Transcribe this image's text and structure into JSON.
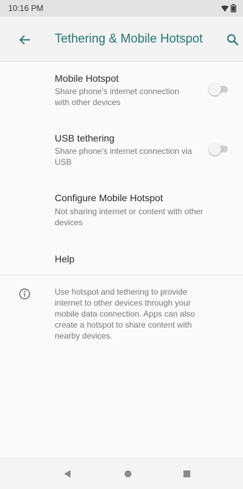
{
  "status_bar": {
    "time": "10:16 PM"
  },
  "app_bar": {
    "title": "Tethering & Mobile Hotspot"
  },
  "preferences": [
    {
      "title": "Mobile Hotspot",
      "summary": "Share phone's internet connection with other devices",
      "toggle_on": false
    },
    {
      "title": "USB tethering",
      "summary": "Share phone's internet connection via USB",
      "toggle_on": false
    },
    {
      "title": "Configure Mobile Hotspot",
      "summary": "Not sharing internet or content with other devices"
    },
    {
      "title": "Help"
    }
  ],
  "footer": {
    "text": "Use hotspot and tethering to provide internet to other devices through your mobile data connection. Apps can also create a hotspot to share content with nearby devices."
  },
  "colors": {
    "accent": "#26786d",
    "status_bar": "#e3e3e3",
    "background": "#fafafa"
  },
  "icons": {
    "back": "arrow-left-icon",
    "search": "search-icon",
    "info": "info-icon",
    "nav_back": "triangle-back-icon",
    "nav_home": "circle-home-icon",
    "nav_recents": "square-recents-icon",
    "wifi": "wifi-icon",
    "battery": "battery-icon"
  }
}
